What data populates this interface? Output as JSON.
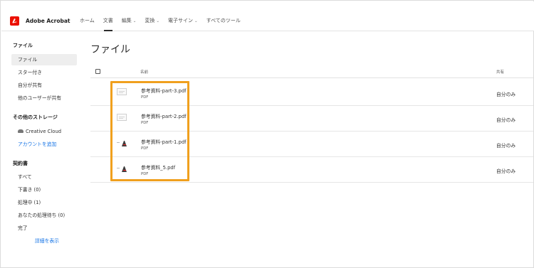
{
  "app": {
    "title": "Adobe Acrobat"
  },
  "nav": {
    "items": [
      {
        "label": "ホーム",
        "dropdown": false
      },
      {
        "label": "文書",
        "dropdown": false
      },
      {
        "label": "編集",
        "dropdown": true
      },
      {
        "label": "変換",
        "dropdown": true
      },
      {
        "label": "電子サイン",
        "dropdown": true
      },
      {
        "label": "すべてのツール",
        "dropdown": false
      }
    ],
    "active_index": 1
  },
  "sidebar": {
    "files_heading": "ファイル",
    "files_items": [
      "ファイル",
      "スター付き",
      "自分が共有",
      "他のユーザーが共有"
    ],
    "storage_heading": "その他のストレージ",
    "storage_items": [
      "Creative Cloud",
      "アカウントを追加"
    ],
    "agreements_heading": "契約書",
    "agreements_items": [
      "すべて",
      "下書き (0)",
      "処理中 (1)",
      "あなたの処理待ち (0)",
      "完了"
    ],
    "details_link": "詳細を表示"
  },
  "main": {
    "title": "ファイル",
    "columns": {
      "name": "名前",
      "shared": "共有"
    },
    "rows": [
      {
        "name": "参考資料-part-3.pdf",
        "type": "PDF",
        "shared": "自分のみ",
        "thumb": "doc"
      },
      {
        "name": "参考資料-part-2.pdf",
        "type": "PDF",
        "shared": "自分のみ",
        "thumb": "doc"
      },
      {
        "name": "参考資料-part-1.pdf",
        "type": "PDF",
        "shared": "自分のみ",
        "thumb": "pdf"
      },
      {
        "name": "参考資料_5.pdf",
        "type": "PDF",
        "shared": "自分のみ",
        "thumb": "pdf"
      }
    ]
  },
  "colors": {
    "brand": "#eb1000",
    "highlight": "#f0a01e",
    "link": "#1473e6",
    "active_bg": "#eeeeee"
  },
  "icons": [
    "acrobat-logo-icon",
    "chevron-down-icon",
    "cloud-icon",
    "checkbox-icon",
    "file-thumbnail-icon"
  ]
}
